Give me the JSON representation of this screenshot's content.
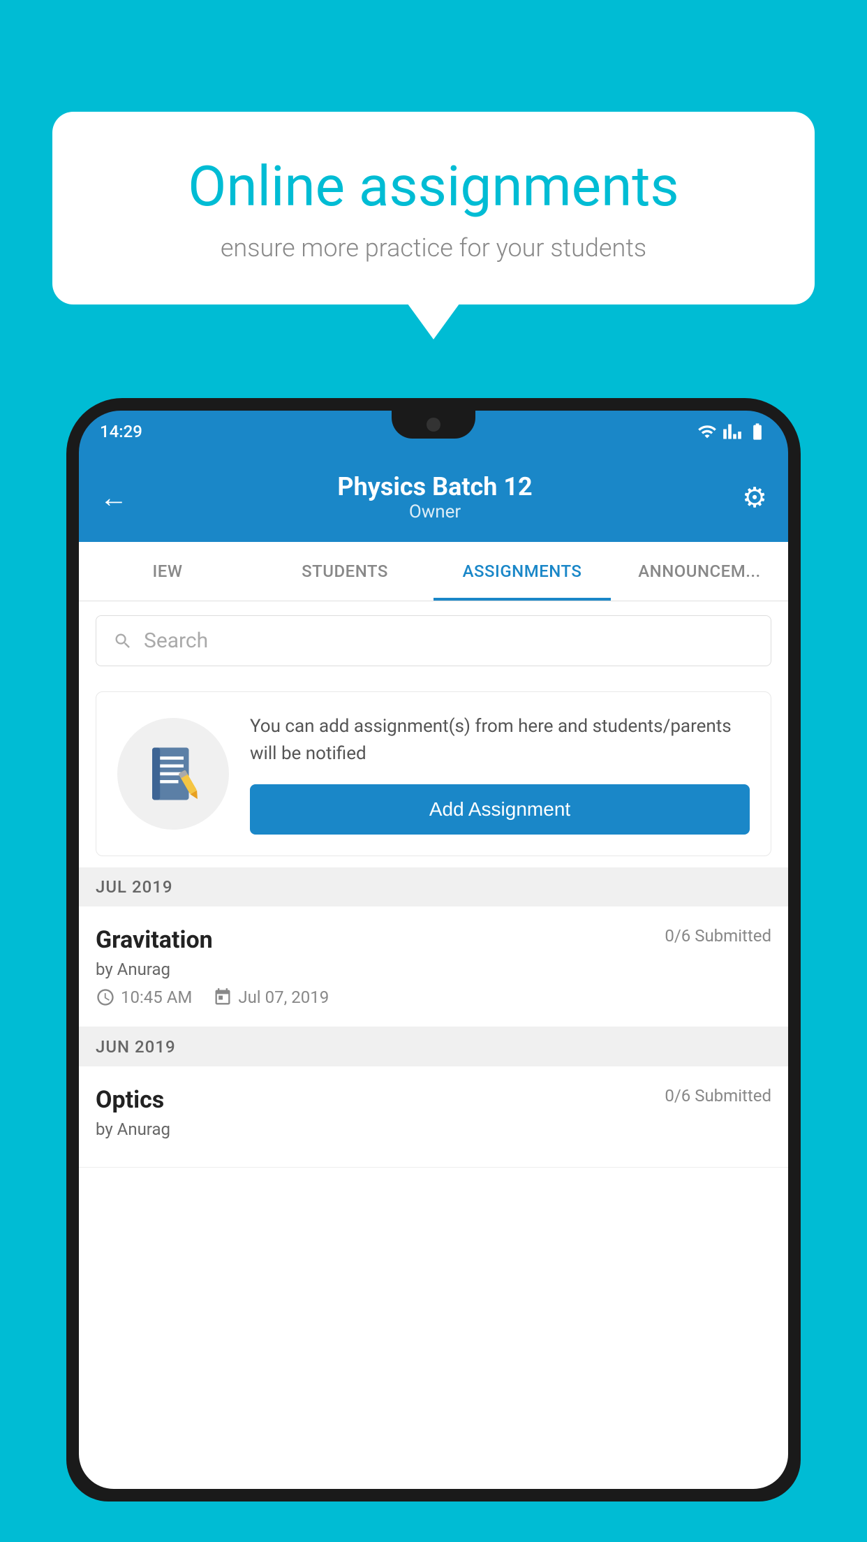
{
  "background_color": "#00BCD4",
  "speech_bubble": {
    "title": "Online assignments",
    "subtitle": "ensure more practice for your students"
  },
  "phone": {
    "status_bar": {
      "time": "14:29"
    },
    "header": {
      "title": "Physics Batch 12",
      "subtitle": "Owner",
      "back_label": "←",
      "settings_label": "⚙"
    },
    "tabs": [
      {
        "label": "IEW",
        "active": false
      },
      {
        "label": "STUDENTS",
        "active": false
      },
      {
        "label": "ASSIGNMENTS",
        "active": true
      },
      {
        "label": "ANNOUNCEM...",
        "active": false
      }
    ],
    "search": {
      "placeholder": "Search"
    },
    "empty_state": {
      "description": "You can add assignment(s) from here and students/parents will be notified",
      "button_label": "Add Assignment"
    },
    "month_sections": [
      {
        "month": "JUL 2019",
        "assignments": [
          {
            "name": "Gravitation",
            "submitted": "0/6 Submitted",
            "by": "by Anurag",
            "time": "10:45 AM",
            "date": "Jul 07, 2019"
          }
        ]
      },
      {
        "month": "JUN 2019",
        "assignments": [
          {
            "name": "Optics",
            "submitted": "0/6 Submitted",
            "by": "by Anurag",
            "time": "",
            "date": ""
          }
        ]
      }
    ]
  }
}
